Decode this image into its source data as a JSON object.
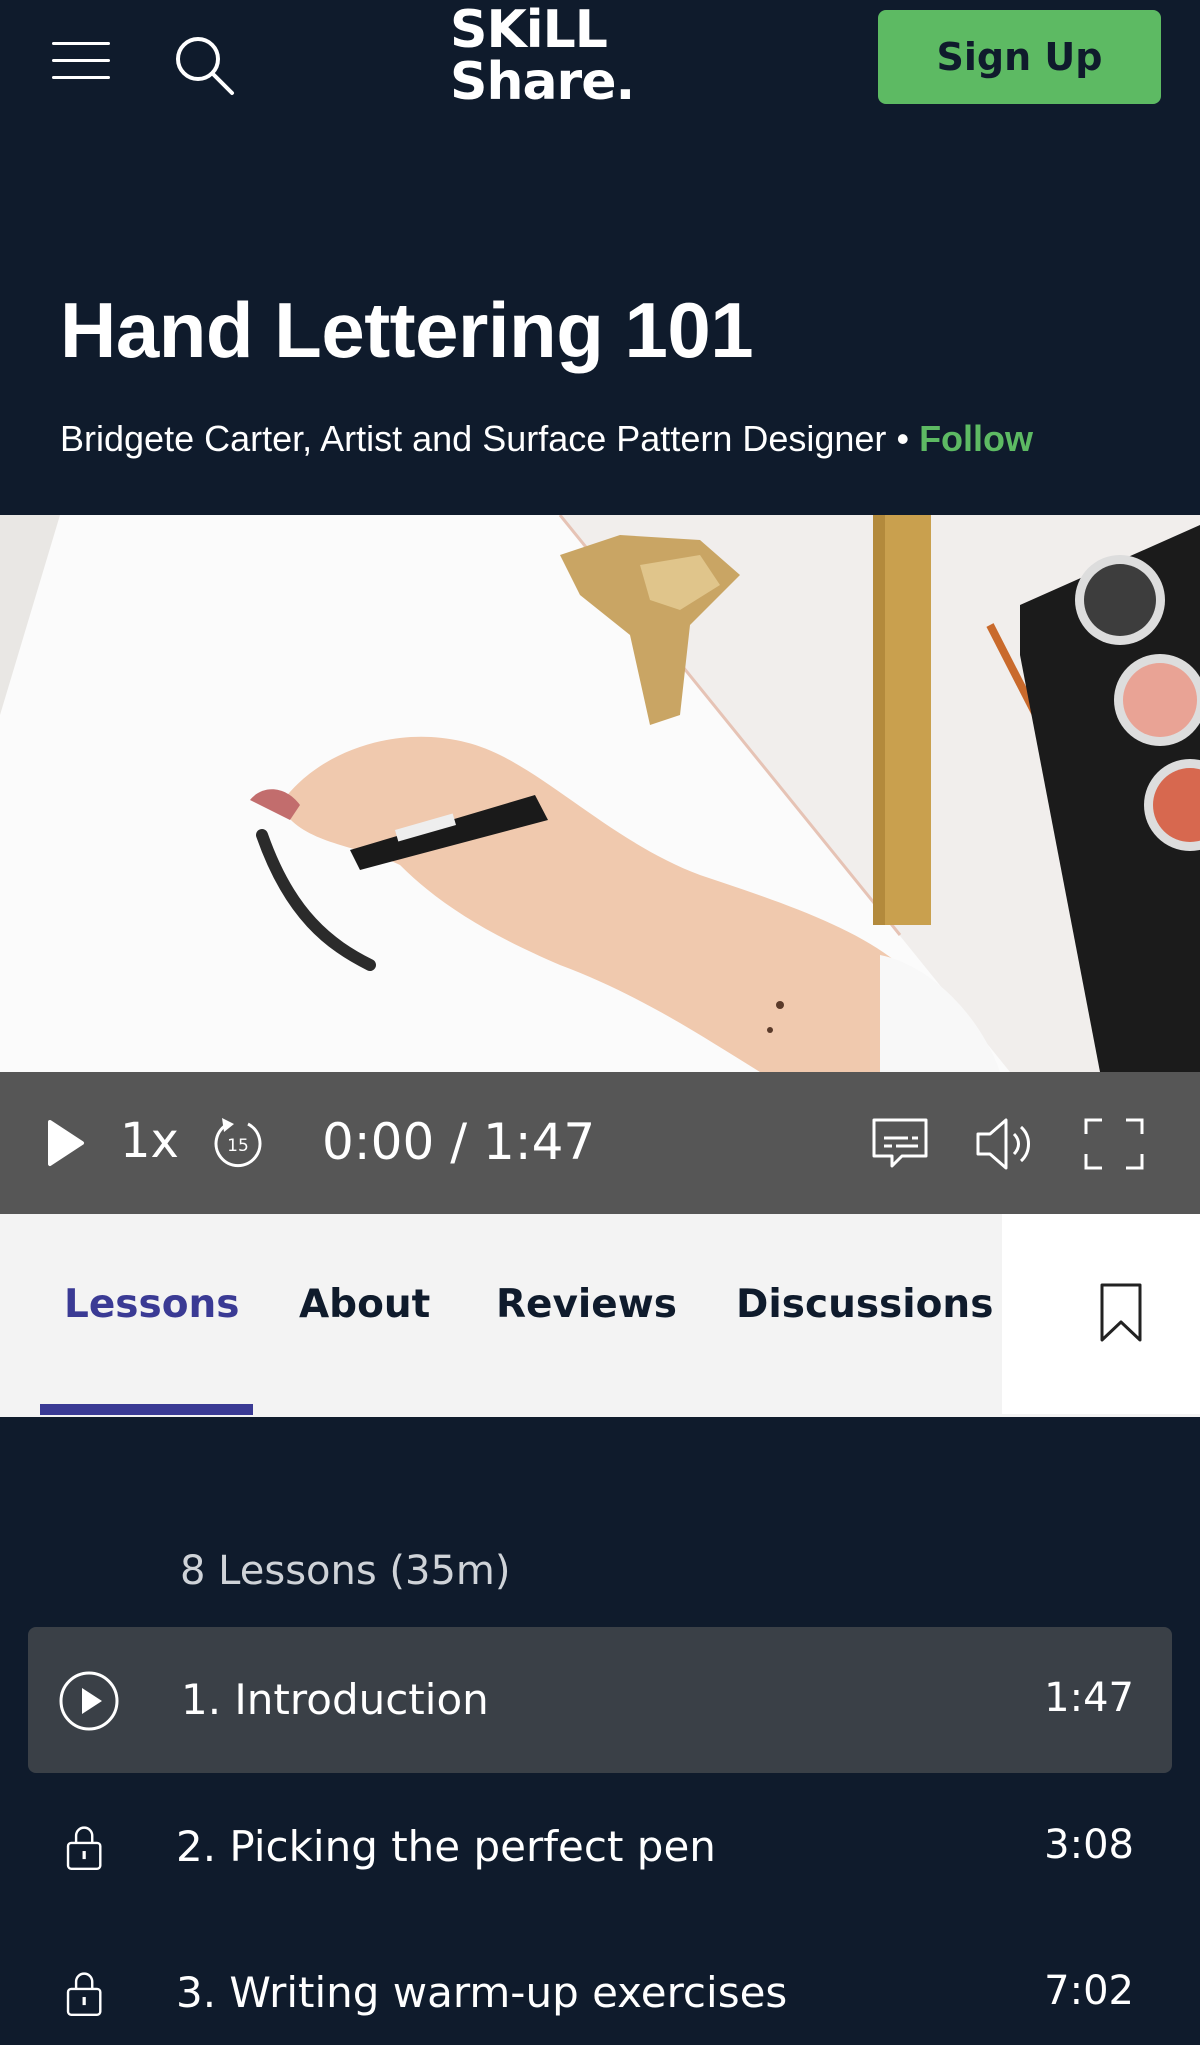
{
  "header": {
    "logo_line1": "SKiLL",
    "logo_line2": "Share.",
    "signup_label": "Sign Up"
  },
  "course": {
    "title": "Hand Lettering 101",
    "instructor": "Bridgete Carter, Artist and Surface Pattern Designer",
    "separator": "•",
    "follow_label": "Follow"
  },
  "player": {
    "speed": "1x",
    "skip_seconds": "15",
    "current_time": "0:00",
    "time_separator": "/",
    "duration": "1:47"
  },
  "tabs": [
    {
      "label": "Lessons",
      "active": true
    },
    {
      "label": "About"
    },
    {
      "label": "Reviews"
    },
    {
      "label": "Discussions"
    }
  ],
  "lessons": {
    "summary": "8 Lessons (35m)",
    "items": [
      {
        "title": "1. Introduction",
        "duration": "1:47",
        "state": "playing",
        "icon": "play-circle-icon"
      },
      {
        "title": "2. Picking the perfect pen",
        "duration": "3:08",
        "state": "locked",
        "icon": "lock-icon"
      },
      {
        "title": "3. Writing warm-up exercises",
        "duration": "7:02",
        "state": "locked",
        "icon": "lock-icon"
      }
    ]
  },
  "colors": {
    "background": "#0f1b2c",
    "accent_green": "#5dba63",
    "tab_active": "#3a3a94",
    "control_bar": "#565656"
  }
}
